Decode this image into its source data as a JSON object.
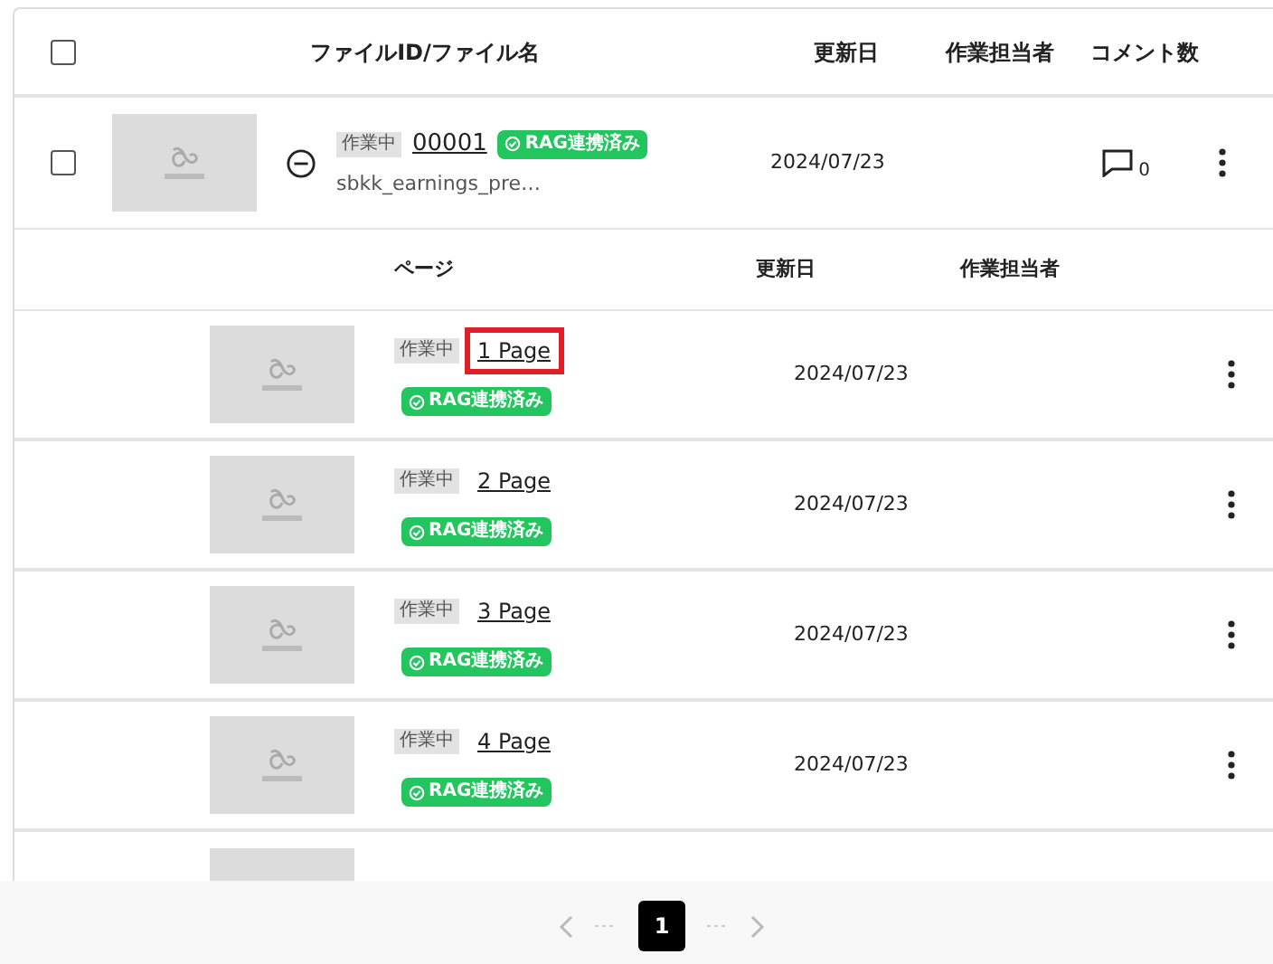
{
  "header": {
    "checked": false,
    "columns": [
      "ファイルID/ファイル名",
      "更新日",
      "作業担当者",
      "コメント数"
    ]
  },
  "file": {
    "checked": false,
    "expanded": true,
    "status": "作業中",
    "id": "00001",
    "rag_badge": "RAG連携済み",
    "filename": "sbkk_earnings_pre…",
    "updated": "2024/07/23",
    "comments": "0"
  },
  "pages_header": {
    "columns": [
      "ページ",
      "更新日",
      "作業担当者"
    ]
  },
  "pages": [
    {
      "status": "作業中",
      "label": "1 Page",
      "rag_badge": "RAG連携済み",
      "updated": "2024/07/23",
      "highlighted": true
    },
    {
      "status": "作業中",
      "label": "2 Page",
      "rag_badge": "RAG連携済み",
      "updated": "2024/07/23",
      "highlighted": false
    },
    {
      "status": "作業中",
      "label": "3 Page",
      "rag_badge": "RAG連携済み",
      "updated": "2024/07/23",
      "highlighted": false
    },
    {
      "status": "作業中",
      "label": "4 Page",
      "rag_badge": "RAG連携済み",
      "updated": "2024/07/23",
      "highlighted": false
    },
    {
      "kind": "cut_off"
    }
  ],
  "pagination": {
    "pages": [
      {
        "label": "1",
        "selected": true
      }
    ]
  }
}
